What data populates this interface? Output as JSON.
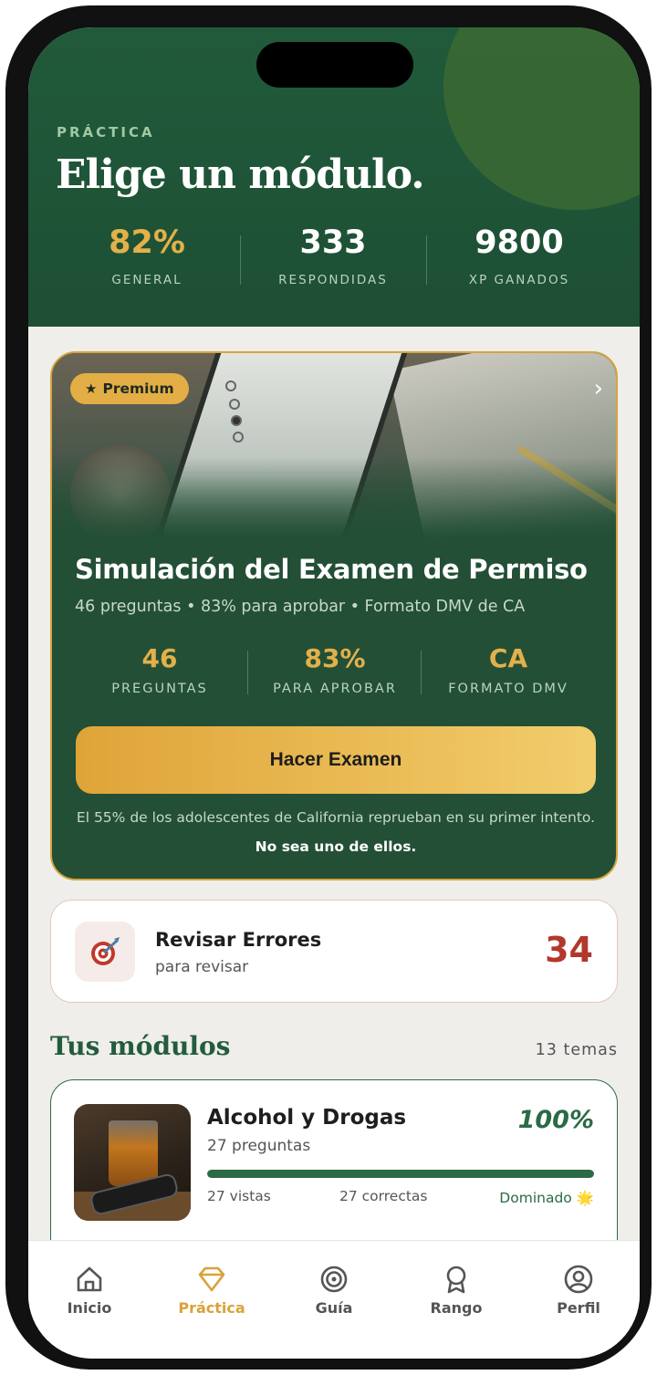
{
  "header": {
    "eyebrow": "PRÁCTICA",
    "title": "Elige un módulo.",
    "stats": [
      {
        "value": "82%",
        "label": "GENERAL"
      },
      {
        "value": "333",
        "label": "RESPONDIDAS"
      },
      {
        "value": "9800",
        "label": "XP GANADOS"
      }
    ]
  },
  "premium": {
    "badge": "Premium",
    "title": "Simulación del Examen de Permiso",
    "subtitle": "46 preguntas • 83% para aprobar • Formato DMV de CA",
    "stats": [
      {
        "value": "46",
        "label": "PREGUNTAS"
      },
      {
        "value": "83%",
        "label": "PARA APROBAR"
      },
      {
        "value": "CA",
        "label": "FORMATO DMV"
      }
    ],
    "cta": "Hacer Examen",
    "note": "El 55% de los adolescentes de California reprueban en su primer intento.",
    "note_bold": "No sea uno de ellos."
  },
  "review": {
    "title": "Revisar Errores",
    "subtitle": "para revisar",
    "count": "34"
  },
  "modules": {
    "title": "Tus módulos",
    "count": "13 temas",
    "items": [
      {
        "title": "Alcohol y Drogas",
        "subtitle": "27 preguntas",
        "percent": "100%",
        "progress": 1.0,
        "views": "27 vistas",
        "correct": "27 correctas",
        "status": "Dominado 🌟"
      }
    ]
  },
  "tabbar": {
    "items": [
      {
        "label": "Inicio",
        "icon": "home-icon"
      },
      {
        "label": "Práctica",
        "icon": "diamond-icon",
        "active": true
      },
      {
        "label": "Guía",
        "icon": "target-icon"
      },
      {
        "label": "Rango",
        "icon": "award-icon"
      },
      {
        "label": "Perfil",
        "icon": "user-icon"
      }
    ]
  },
  "colors": {
    "brand_green": "#215a3b",
    "accent_gold": "#e3b04a",
    "error_red": "#b2382b"
  }
}
